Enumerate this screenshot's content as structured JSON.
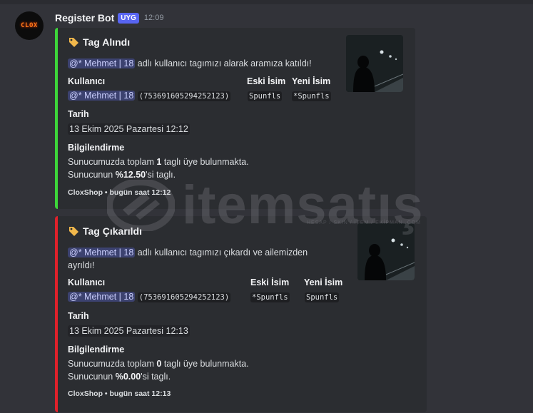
{
  "message": {
    "author": "Register Bot",
    "badge": "UYG",
    "time": "12:09",
    "avatar_text": "CLOX"
  },
  "embeds": [
    {
      "color": "#3dd63a",
      "title": "Tag Alındı",
      "icon": "tag-icon",
      "mention": "@* Mehmet | 18",
      "desc_rest": " adlı kullanıcı tagımızı alarak aramıza katıldı!",
      "fields": {
        "user_label": "Kullanıcı",
        "user_mention": "@* Mehmet | 18",
        "user_id": "(753691605294252123)",
        "old_label": "Eski İsim",
        "old_value": "Spunfls",
        "new_label": "Yeni İsim",
        "new_value": "*Spunfls",
        "date_label": "Tarih",
        "date_value": "13 Ekim 2025 Pazartesi 12:12",
        "info_label": "Bilgilendirme",
        "info_line1_a": "Sunucumuzda toplam ",
        "info_line1_num": "1",
        "info_line1_b": " taglı üye bulunmakta.",
        "info_line2_a": "Sunucunun ",
        "info_line2_num": "%12.50",
        "info_line2_b": "'si taglı."
      },
      "footer": "CloxShop • bugün saat 12:12"
    },
    {
      "color": "#e0212b",
      "title": "Tag Çıkarıldı",
      "icon": "tag-icon",
      "mention": "@* Mehmet | 18",
      "desc_rest": " adlı kullanıcı tagımızı çıkardı ve ailemizden",
      "desc_line2": "ayrıldı!",
      "fields": {
        "user_label": "Kullanıcı",
        "user_mention": "@* Mehmet | 18",
        "user_id": "(753691605294252123)",
        "old_label": "Eski İsim",
        "old_value": "*Spunfls",
        "new_label": "Yeni İsim",
        "new_value": "Spunfls",
        "date_label": "Tarih",
        "date_value": "13 Ekim 2025 Pazartesi 12:13",
        "info_label": "Bilgilendirme",
        "info_line1_a": "Sunucumuzda toplam ",
        "info_line1_num": "0",
        "info_line1_b": " taglı üye bulunmakta.",
        "info_line2_a": "Sunucunun ",
        "info_line2_num": "%0.00",
        "info_line2_b": "'si taglı."
      },
      "footer": "CloxShop • bugün saat 12:13"
    }
  ],
  "watermark": {
    "text": "itemsatış",
    "sub": "HESAP / SKIN / İTEM / EKİPMAN .COM"
  }
}
